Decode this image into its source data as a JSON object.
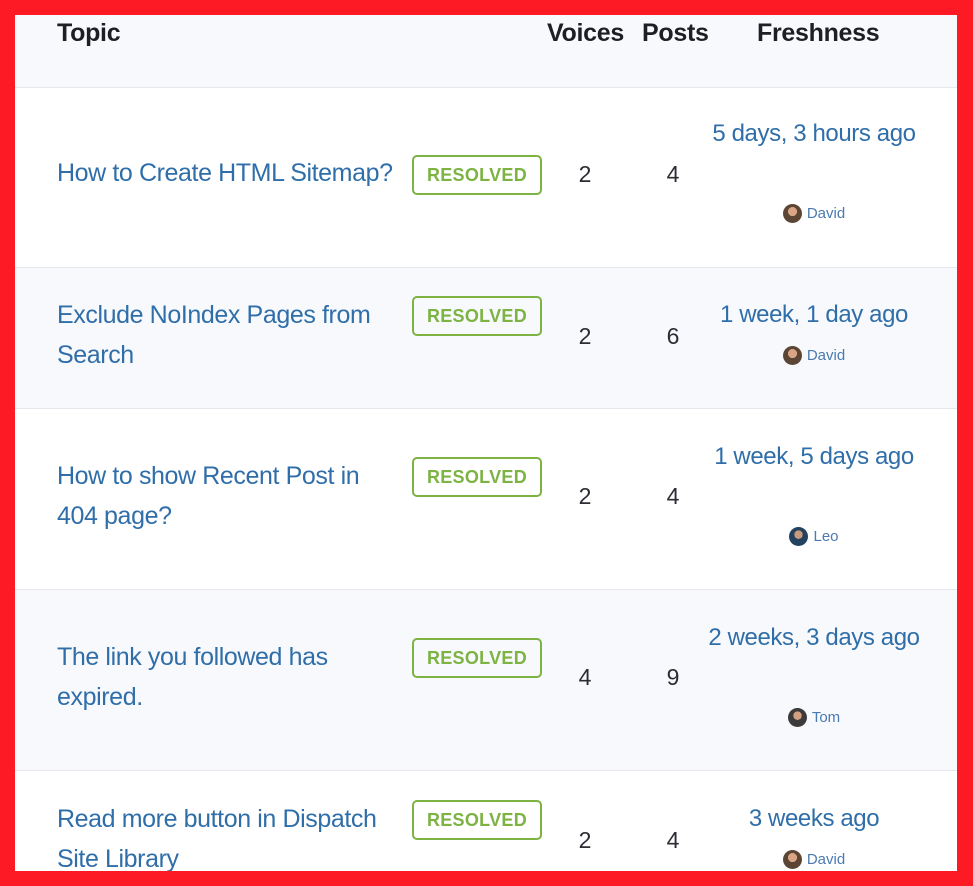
{
  "header": {
    "topic": "Topic",
    "voices": "Voices",
    "posts": "Posts",
    "freshness": "Freshness"
  },
  "colors": {
    "border": "#fe1a25",
    "link": "#2f6ea8",
    "resolved": "#7cb342",
    "alt_row": "#f8f9fc"
  },
  "topics": [
    {
      "title": "How to Create HTML Sitemap?",
      "status": "RESOLVED",
      "voices": "2",
      "posts": "4",
      "freshness": "5 days, 3 hours ago",
      "author": "David",
      "avatar_icon": "avatar-icon"
    },
    {
      "title": "Exclude NoIndex Pages from Search",
      "status": "RESOLVED",
      "voices": "2",
      "posts": "6",
      "freshness": "1 week, 1 day ago",
      "author": "David",
      "avatar_icon": "avatar-icon"
    },
    {
      "title": "How to show Recent Post in 404 page?",
      "status": "RESOLVED",
      "voices": "2",
      "posts": "4",
      "freshness": "1 week, 5 days ago",
      "author": "Leo",
      "avatar_icon": "avatar-icon"
    },
    {
      "title": "The link you followed has expired.",
      "status": "RESOLVED",
      "voices": "4",
      "posts": "9",
      "freshness": "2 weeks, 3 days ago",
      "author": "Tom",
      "avatar_icon": "avatar-icon"
    },
    {
      "title": "Read more button in Dispatch Site Library",
      "status": "RESOLVED",
      "voices": "2",
      "posts": "4",
      "freshness": "3 weeks ago",
      "author": "David",
      "avatar_icon": "avatar-icon"
    }
  ]
}
